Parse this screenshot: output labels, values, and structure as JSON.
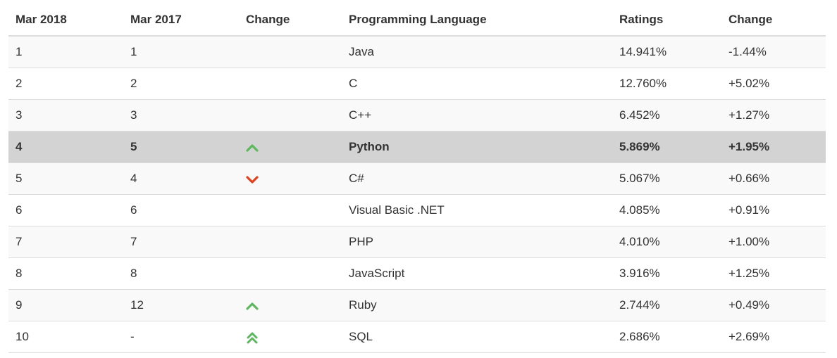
{
  "colors": {
    "up": "#5cb85c",
    "down": "#e0401a",
    "highlight_row": "#d3d3d3",
    "stripe": "#f9f9f9",
    "border": "#dddddd",
    "text": "#333333"
  },
  "table": {
    "headers": {
      "mar2018": "Mar 2018",
      "mar2017": "Mar 2017",
      "change": "Change",
      "language": "Programming Language",
      "ratings": "Ratings",
      "change_pct": "Change"
    },
    "rows": [
      {
        "mar2018": "1",
        "mar2017": "1",
        "trend": "",
        "language": "Java",
        "ratings": "14.941%",
        "change_pct": "-1.44%"
      },
      {
        "mar2018": "2",
        "mar2017": "2",
        "trend": "",
        "language": "C",
        "ratings": "12.760%",
        "change_pct": "+5.02%"
      },
      {
        "mar2018": "3",
        "mar2017": "3",
        "trend": "",
        "language": "C++",
        "ratings": "6.452%",
        "change_pct": "+1.27%"
      },
      {
        "mar2018": "4",
        "mar2017": "5",
        "trend": "up-icon",
        "language": "Python",
        "ratings": "5.869%",
        "change_pct": "+1.95%",
        "highlighted": true
      },
      {
        "mar2018": "5",
        "mar2017": "4",
        "trend": "down-icon",
        "language": "C#",
        "ratings": "5.067%",
        "change_pct": "+0.66%"
      },
      {
        "mar2018": "6",
        "mar2017": "6",
        "trend": "",
        "language": "Visual Basic .NET",
        "ratings": "4.085%",
        "change_pct": "+0.91%"
      },
      {
        "mar2018": "7",
        "mar2017": "7",
        "trend": "",
        "language": "PHP",
        "ratings": "4.010%",
        "change_pct": "+1.00%"
      },
      {
        "mar2018": "8",
        "mar2017": "8",
        "trend": "",
        "language": "JavaScript",
        "ratings": "3.916%",
        "change_pct": "+1.25%"
      },
      {
        "mar2018": "9",
        "mar2017": "12",
        "trend": "up-icon",
        "language": "Ruby",
        "ratings": "2.744%",
        "change_pct": "+0.49%"
      },
      {
        "mar2018": "10",
        "mar2017": "-",
        "trend": "double-up-icon",
        "language": "SQL",
        "ratings": "2.686%",
        "change_pct": "+2.69%"
      }
    ]
  }
}
